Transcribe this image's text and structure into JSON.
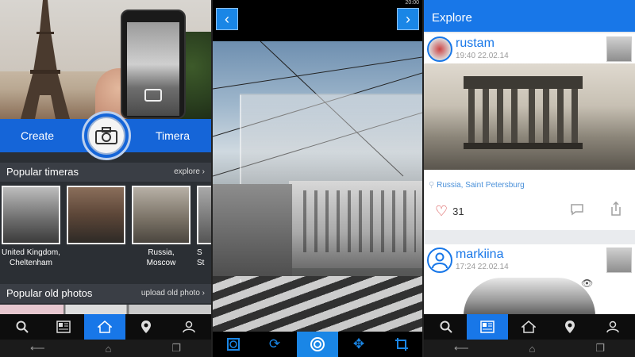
{
  "panel_home": {
    "actions": {
      "create_label": "Create",
      "timera_label": "Timera"
    },
    "popular_timeras": {
      "title": "Popular timeras",
      "link": "explore",
      "items": [
        {
          "caption": "United Kingdom,\nCheltenham"
        },
        {
          "caption": ""
        },
        {
          "caption": "Russia,\nMoscow"
        },
        {
          "caption": "S\nSt"
        }
      ]
    },
    "popular_old_photos": {
      "title": "Popular old photos",
      "link": "upload old photo"
    },
    "bottom_nav": [
      "search-icon",
      "newspaper-icon",
      "home-icon",
      "location-pin-icon",
      "profile-icon"
    ],
    "active_nav_index": 2
  },
  "panel_editor": {
    "tools": [
      "square-frame-icon",
      "refresh-icon",
      "circle-target-icon",
      "move-arrows-icon",
      "crop-icon"
    ],
    "active_tool_index": 2,
    "status_fragment": "20:00"
  },
  "panel_explore": {
    "title": "Explore",
    "posts": [
      {
        "user": "rustam",
        "time": "19:40 22.02.14",
        "location": "Russia, Saint Petersburg",
        "likes": "31"
      },
      {
        "user": "markiina",
        "time": "17:24 22.02.14"
      }
    ],
    "bottom_nav": [
      "search-icon",
      "newspaper-icon",
      "home-icon",
      "location-pin-icon",
      "profile-icon"
    ],
    "active_nav_index": 1
  },
  "system_nav": [
    "back-icon",
    "home-icon",
    "recents-icon"
  ],
  "colors": {
    "accent": "#1877e8",
    "tool_blue": "#1a86e6",
    "heart": "#d64545"
  }
}
